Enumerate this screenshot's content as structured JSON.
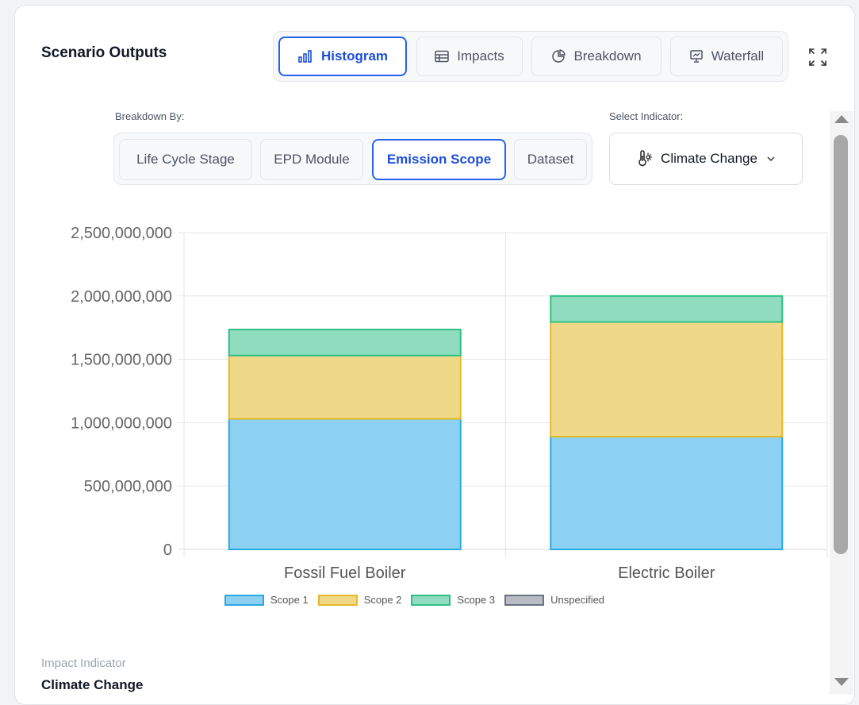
{
  "header": {
    "title": "Scenario Outputs",
    "view_tabs": [
      {
        "label": "Histogram",
        "icon": "bar-chart-icon",
        "active": true
      },
      {
        "label": "Impacts",
        "icon": "table-icon",
        "active": false
      },
      {
        "label": "Breakdown",
        "icon": "pie-chart-icon",
        "active": false
      },
      {
        "label": "Waterfall",
        "icon": "presentation-chart-icon",
        "active": false
      }
    ],
    "expand_icon": "expand-icon"
  },
  "controls": {
    "breakdown_label": "Breakdown By:",
    "breakdown_options": [
      {
        "label": "Life Cycle Stage",
        "active": false
      },
      {
        "label": "EPD Module",
        "active": false
      },
      {
        "label": "Emission Scope",
        "active": true
      },
      {
        "label": "Dataset",
        "active": false
      }
    ],
    "indicator_label": "Select Indicator:",
    "indicator_value": "Climate Change",
    "indicator_icon": "thermometer-sun-icon"
  },
  "chart_data": {
    "type": "bar",
    "stacked": true,
    "categories": [
      "Fossil Fuel Boiler",
      "Electric Boiler"
    ],
    "series": [
      {
        "name": "Scope 1",
        "values": [
          1030000000,
          890000000
        ],
        "fill": "#8dd1f2",
        "stroke": "#2aa8e0"
      },
      {
        "name": "Scope 2",
        "values": [
          500000000,
          905000000
        ],
        "fill": "#f0d889",
        "stroke": "#e5b82a"
      },
      {
        "name": "Scope 3",
        "values": [
          205000000,
          205000000
        ],
        "fill": "#8fdcbf",
        "stroke": "#2dbf84"
      },
      {
        "name": "Unspecified",
        "values": [
          0,
          0
        ],
        "fill": "#b7bcc4",
        "stroke": "#6b7280"
      }
    ],
    "ylim": [
      0,
      2500000000
    ],
    "yticks": [
      "0",
      "500,000,000",
      "1,000,000,000",
      "1,500,000,000",
      "2,000,000,000",
      "2,500,000,000"
    ],
    "grid": true,
    "legend_position": "bottom"
  },
  "footer": {
    "impact_indicator_label": "Impact Indicator",
    "impact_indicator_value": "Climate Change"
  }
}
